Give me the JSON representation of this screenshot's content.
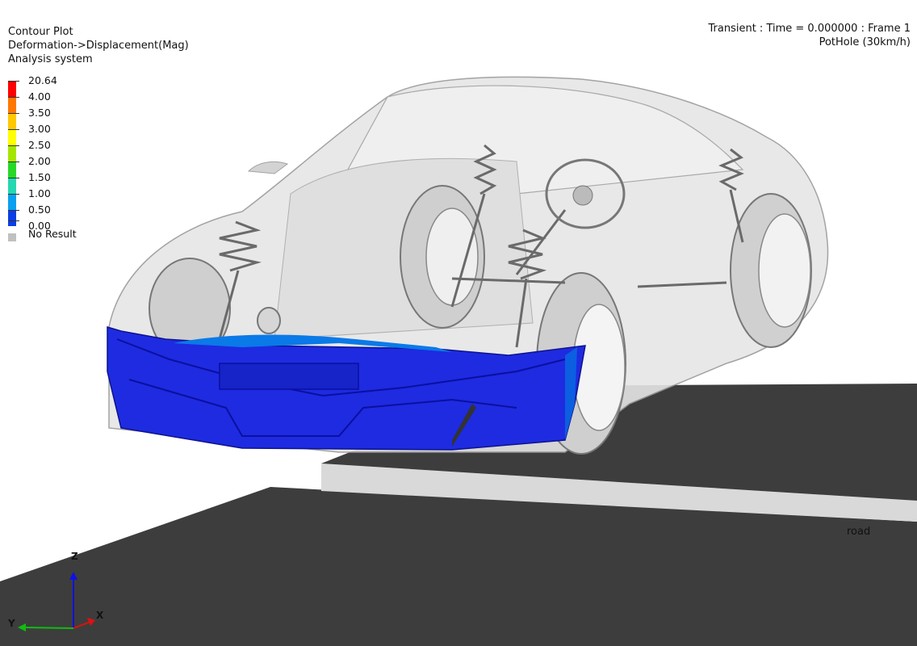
{
  "header": {
    "line1": "Contour Plot",
    "line2": "Deformation->Displacement(Mag)",
    "line3": "Analysis system"
  },
  "legend": {
    "entries": [
      {
        "value": "20.64",
        "color": "#ff0000"
      },
      {
        "value": "4.00",
        "color": "#ff7700"
      },
      {
        "value": "3.50",
        "color": "#ffc800"
      },
      {
        "value": "3.00",
        "color": "#ffff00"
      },
      {
        "value": "2.50",
        "color": "#a5e600"
      },
      {
        "value": "2.00",
        "color": "#27d927"
      },
      {
        "value": "1.50",
        "color": "#24d8b1"
      },
      {
        "value": "1.00",
        "color": "#0aa0f0"
      },
      {
        "value": "0.50",
        "color": "#0b3ee6"
      },
      {
        "value": "0.00",
        "color": "#0000b4"
      }
    ],
    "no_result_label": "No Result",
    "no_result_color": "#c0c0c0"
  },
  "info": {
    "line1": "Transient : Time = 0.000000 : Frame 1",
    "line2": "PotHole (30km/h)"
  },
  "road_label": "road",
  "triad": {
    "z": "Z",
    "y": "Y",
    "x": "X"
  },
  "colors": {
    "road_dark": "#3d3d3d",
    "road_curb": "#d9d9d9",
    "bumper": "#1e2be0",
    "body_translucent": "#d9d9d9"
  }
}
